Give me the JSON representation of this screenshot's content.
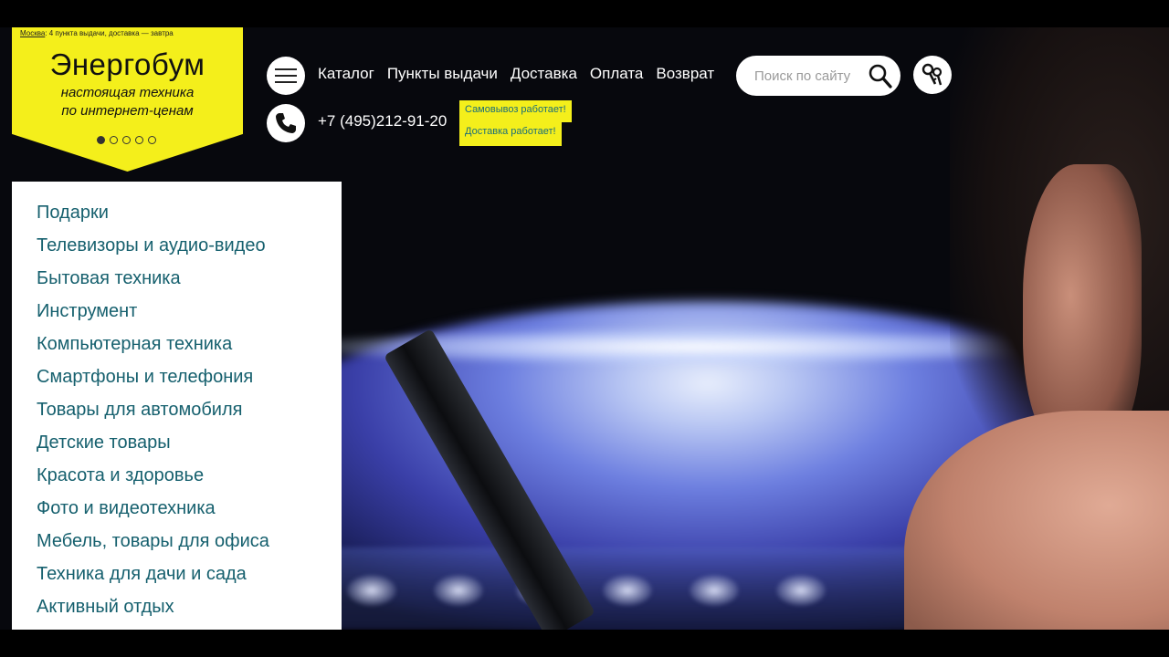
{
  "header": {
    "location_city": "Москва",
    "location_text": ": 4 пункта выдачи, доставка — завтра",
    "brand_name": "Энергобум",
    "tagline_line1": "настоящая техника",
    "tagline_line2": "по интернет-ценам",
    "slider_dot_count": 5,
    "slider_active_index": 0,
    "nav": [
      {
        "label": "Каталог"
      },
      {
        "label": "Пункты выдачи"
      },
      {
        "label": "Доставка"
      },
      {
        "label": "Оплата"
      },
      {
        "label": "Возврат"
      }
    ],
    "phone": "+7 (495)212-91-20",
    "notice_pickup": "Самовывоз работает!",
    "notice_delivery": "Доставка работает!"
  },
  "search": {
    "placeholder": "Поиск по сайту"
  },
  "icons": {
    "menu": "hamburger-menu-icon",
    "phone": "phone-handset-icon",
    "search": "magnifier-icon",
    "account": "keys-icon"
  },
  "colors": {
    "brand_yellow": "#f4ef1b",
    "category_link": "#16606e",
    "notice_text": "#1a6d7a"
  },
  "categories": [
    {
      "label": "Подарки"
    },
    {
      "label": "Телевизоры и аудио-видео"
    },
    {
      "label": "Бытовая техника"
    },
    {
      "label": "Инструмент"
    },
    {
      "label": "Компьютерная техника"
    },
    {
      "label": "Смартфоны и телефония"
    },
    {
      "label": "Товары для автомобиля"
    },
    {
      "label": "Детские товары"
    },
    {
      "label": "Красота и здоровье"
    },
    {
      "label": "Фото и видеотехника"
    },
    {
      "label": "Мебель, товары для офиса"
    },
    {
      "label": "Техника для дачи и сада"
    },
    {
      "label": "Активный отдых"
    }
  ]
}
